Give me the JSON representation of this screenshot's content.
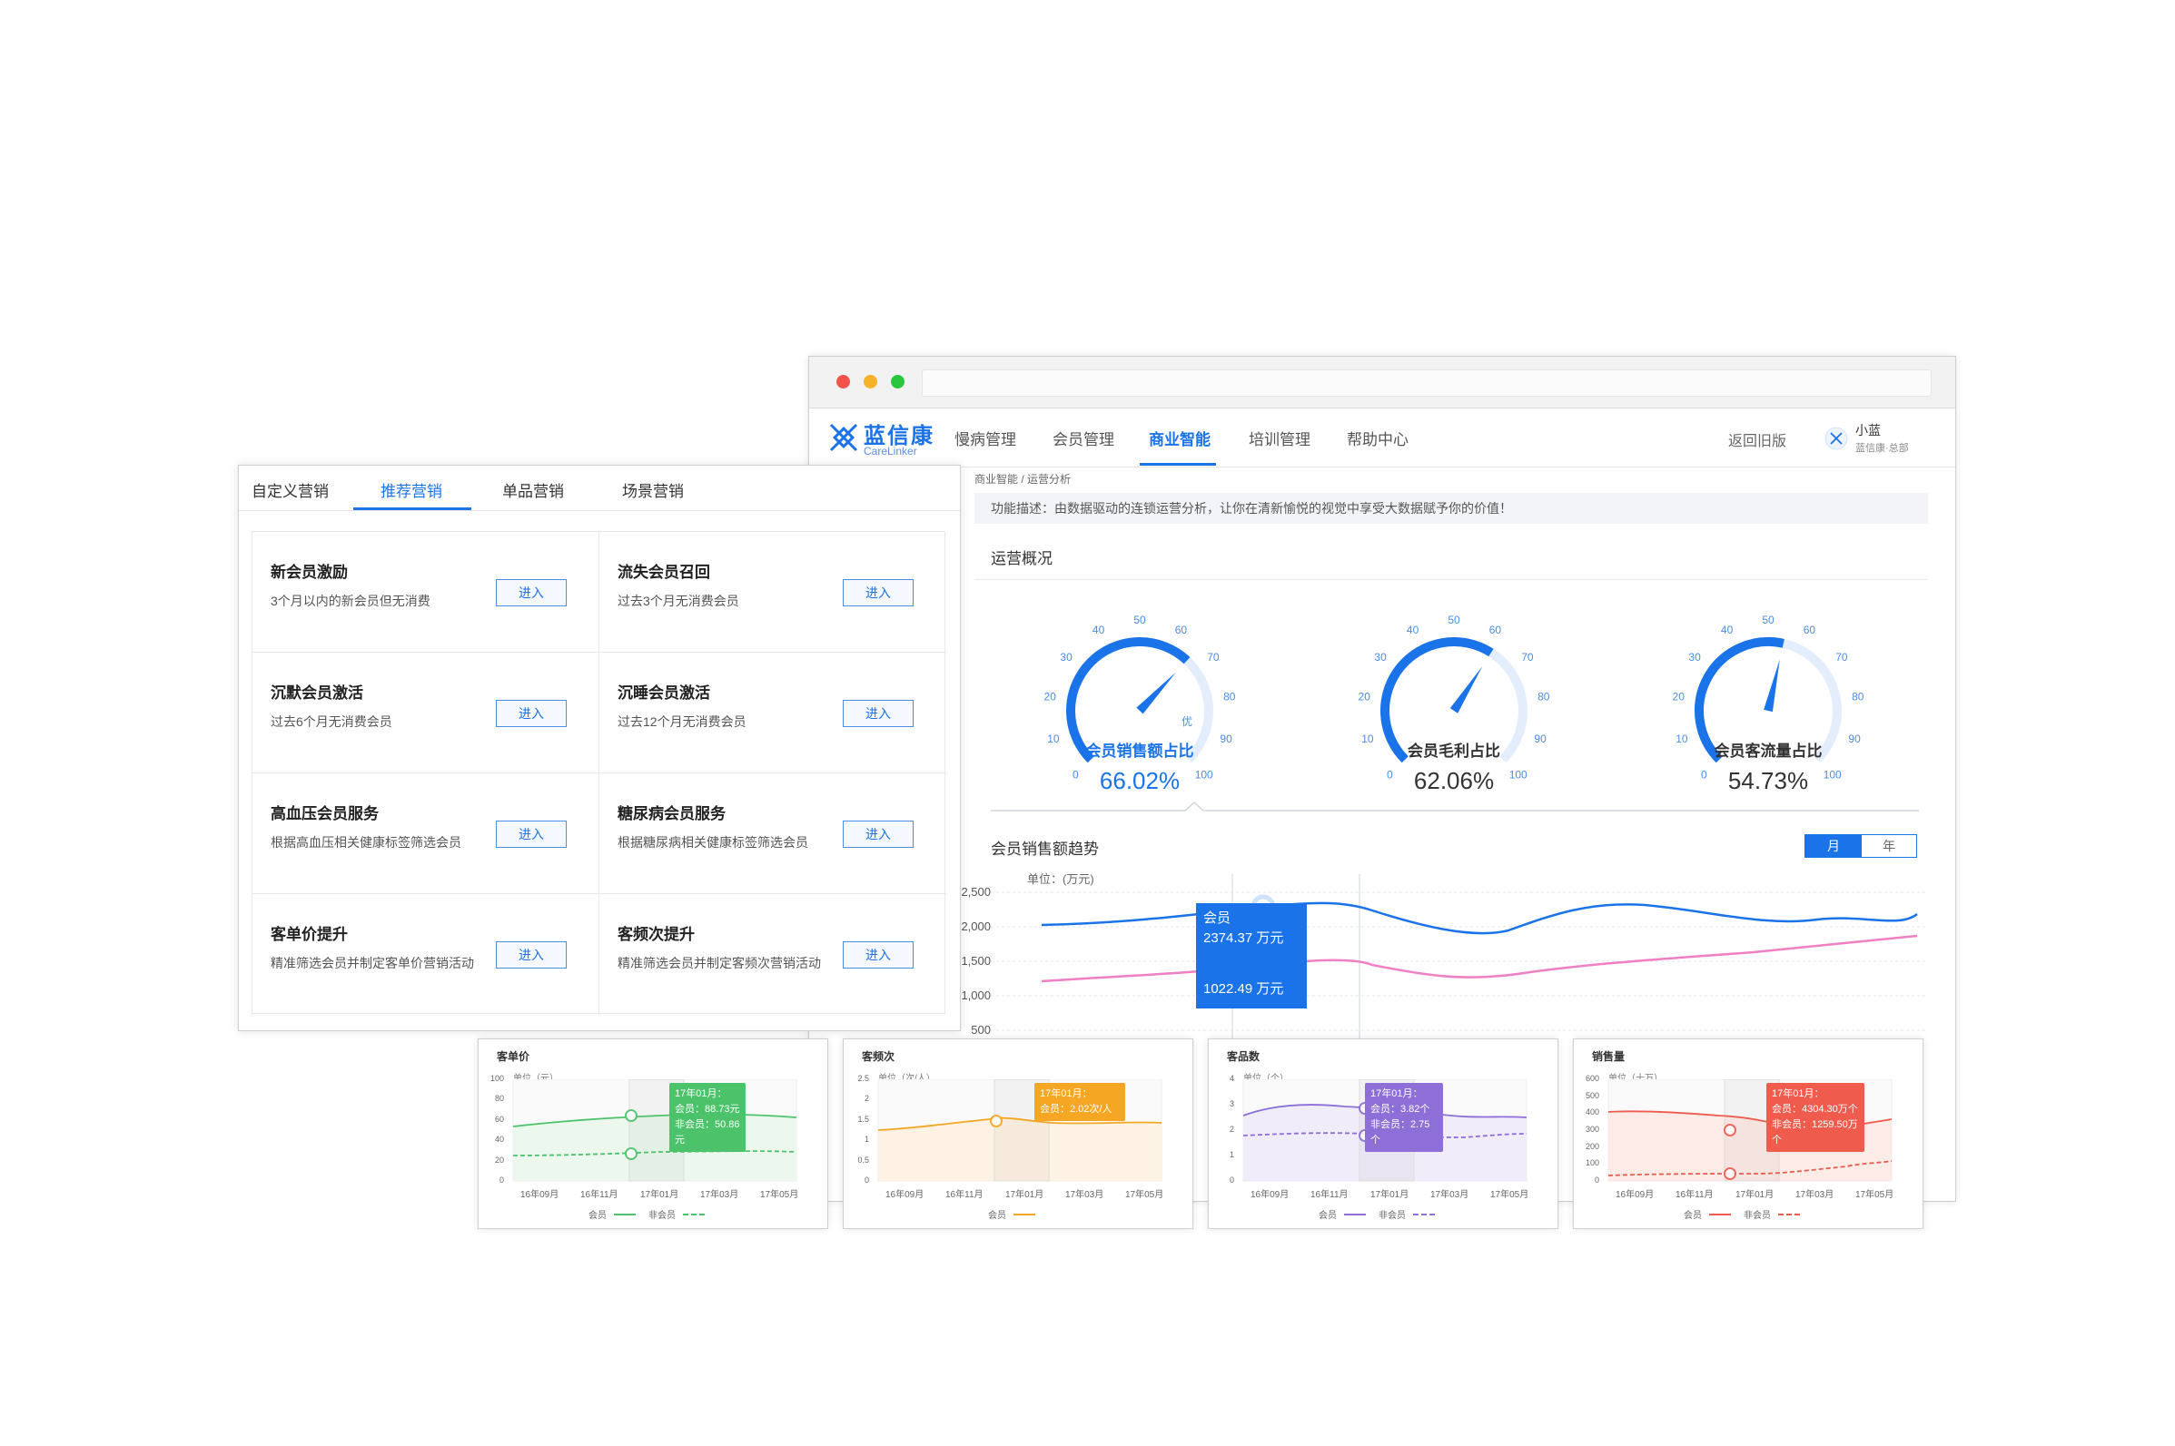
{
  "nav": {
    "logo_text": "蓝信康",
    "logo_sub": "CareLinker",
    "items": [
      "慢病管理",
      "会员管理",
      "商业智能",
      "培训管理",
      "帮助中心"
    ],
    "active_index": 2,
    "return_old": "返回旧版",
    "user_name": "小蓝",
    "user_org": "蓝信康·总部"
  },
  "breadcrumb": "商业智能 / 运营分析",
  "description": "功能描述：由数据驱动的连锁运营分析，让你在清新愉悦的视觉中享受大数据赋予你的价值！",
  "overview": {
    "title": "运营概况",
    "gauges": [
      {
        "label": "会员销售额占比",
        "value_text": "66.02%",
        "value": 66.02,
        "highlight": true,
        "extra_tick": "优"
      },
      {
        "label": "会员毛利占比",
        "value_text": "62.06%",
        "value": 62.06,
        "highlight": false,
        "extra_tick": ""
      },
      {
        "label": "会员客流量占比",
        "value_text": "54.73%",
        "value": 54.73,
        "highlight": false,
        "extra_tick": ""
      }
    ],
    "gauge_ticks": [
      "0",
      "10",
      "20",
      "30",
      "40",
      "50",
      "60",
      "70",
      "80",
      "90",
      "100"
    ]
  },
  "trend": {
    "title": "会员销售额趋势",
    "toggle": [
      "月",
      "年"
    ],
    "unit": "单位：(万元)",
    "yticks": [
      "2,500",
      "2,000",
      "1,500",
      "1,000",
      "500"
    ],
    "tooltip": {
      "name": "会员",
      "member_value": "2374.37 万元",
      "nonmember_value": "1022.49 万元"
    },
    "colors": {
      "member": "#1a73e8",
      "nonmember": "#f07fc3"
    }
  },
  "marketing": {
    "tabs": [
      "自定义营销",
      "推荐营销",
      "单品营销",
      "场景营销"
    ],
    "active_tab": 1,
    "enter_label": "进入",
    "cards": [
      {
        "title": "新会员激励",
        "desc": "3个月以内的新会员但无消费"
      },
      {
        "title": "流失会员召回",
        "desc": "过去3个月无消费会员"
      },
      {
        "title": "沉默会员激活",
        "desc": "过去6个月无消费会员"
      },
      {
        "title": "沉睡会员激活",
        "desc": "过去12个月无消费会员"
      },
      {
        "title": "高血压会员服务",
        "desc": "根据高血压相关健康标签筛选会员"
      },
      {
        "title": "糖尿病会员服务",
        "desc": "根据糖尿病相关健康标签筛选会员"
      },
      {
        "title": "客单价提升",
        "desc": "精准筛选会员并制定客单价营销活动"
      },
      {
        "title": "客频次提升",
        "desc": "精准筛选会员并制定客频次营销活动"
      }
    ]
  },
  "mini_charts": [
    {
      "title": "客单价",
      "unit": "单位（元）",
      "yticks": [
        "100",
        "80",
        "60",
        "40",
        "20",
        "0"
      ],
      "xticks": [
        "16年09月",
        "16年11月",
        "17年01月",
        "17年03月",
        "17年05月"
      ],
      "legend": [
        "会员",
        "非会员"
      ],
      "tooltip": [
        "17年01月：",
        "会员：88.73元",
        "非会员：50.86元"
      ],
      "color": "#4cc36b",
      "fill": "#eaf6ec"
    },
    {
      "title": "客频次",
      "unit": "单位（次/人）",
      "yticks": [
        "2.5",
        "2",
        "1.5",
        "1",
        "0.5",
        "0"
      ],
      "xticks": [
        "16年09月",
        "16年11月",
        "17年01月",
        "17年03月",
        "17年05月"
      ],
      "legend": [
        "会员"
      ],
      "tooltip": [
        "17年01月：",
        "会员：2.02次/人"
      ],
      "color": "#f5a623",
      "fill": "#fdf1e1"
    },
    {
      "title": "客品数",
      "unit": "单位（个）",
      "yticks": [
        "4",
        "3",
        "2",
        "1",
        "0"
      ],
      "xticks": [
        "16年09月",
        "16年11月",
        "17年01月",
        "17年03月",
        "17年05月"
      ],
      "legend": [
        "会员",
        "非会员"
      ],
      "tooltip": [
        "17年01月：",
        "会员：3.82个",
        "非会员：2.75个"
      ],
      "color": "#8e6fd8",
      "fill": "#efeafa"
    },
    {
      "title": "销售量",
      "unit": "单位（十万）",
      "yticks": [
        "600",
        "500",
        "400",
        "300",
        "200",
        "100",
        "0"
      ],
      "xticks": [
        "16年09月",
        "16年11月",
        "17年01月",
        "17年03月",
        "17年05月"
      ],
      "legend": [
        "会员",
        "非会员"
      ],
      "tooltip": [
        "17年01月：",
        "会员：4304.30万个",
        "非会员：1259.50万个"
      ],
      "color": "#ef5b4c",
      "fill": "#fde9e6"
    }
  ]
}
